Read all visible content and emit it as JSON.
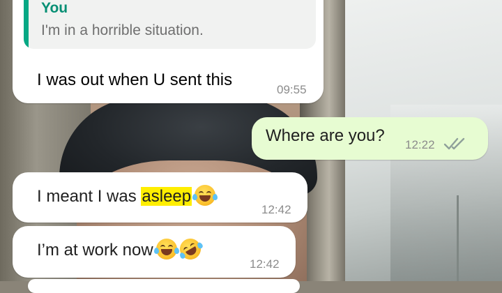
{
  "messages": [
    {
      "quote_author": "You",
      "quote_text": "I'm in a horrible situation.",
      "text": "I was out when U sent this",
      "time": "09:55"
    },
    {
      "text": "Where are you?",
      "time": "12:22",
      "status_icon": "double-check-read-icon"
    },
    {
      "text_before": "I meant I was ",
      "highlight": "asleep",
      "emoji": "face-with-tears-of-joy-icon",
      "time": "12:42"
    },
    {
      "text": "I’m at work now",
      "emojis": [
        "face-with-tears-of-joy-icon",
        "rolling-on-the-floor-laughing-icon"
      ],
      "time": "12:42"
    }
  ],
  "colors": {
    "incoming_bubble": "#ffffff",
    "outgoing_bubble": "#e7fcd2",
    "quote_accent": "#06a884",
    "highlight": "#ffee00",
    "read_ticks": "#8fa09a"
  }
}
